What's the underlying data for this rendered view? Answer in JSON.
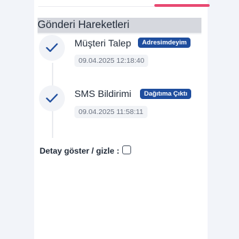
{
  "section": {
    "title": "Gönderi Hareketleri"
  },
  "timeline": {
    "steps": [
      {
        "title": "Müşteri Talep",
        "badge": "Adresimdeyim",
        "timestamp": "09.04.2025 12:18:40",
        "icon": "check-icon"
      },
      {
        "title": "SMS Bildirimi",
        "badge": "Dağıtıma Çıktı",
        "timestamp": "09.04.2025 11:58:11",
        "icon": "check-icon"
      }
    ]
  },
  "details_toggle": {
    "label": "Detay göster / gizle :",
    "checked": false
  },
  "colors": {
    "accent": "#e84a72",
    "badge": "#1f4e9e",
    "check": "#1f4e9e"
  }
}
